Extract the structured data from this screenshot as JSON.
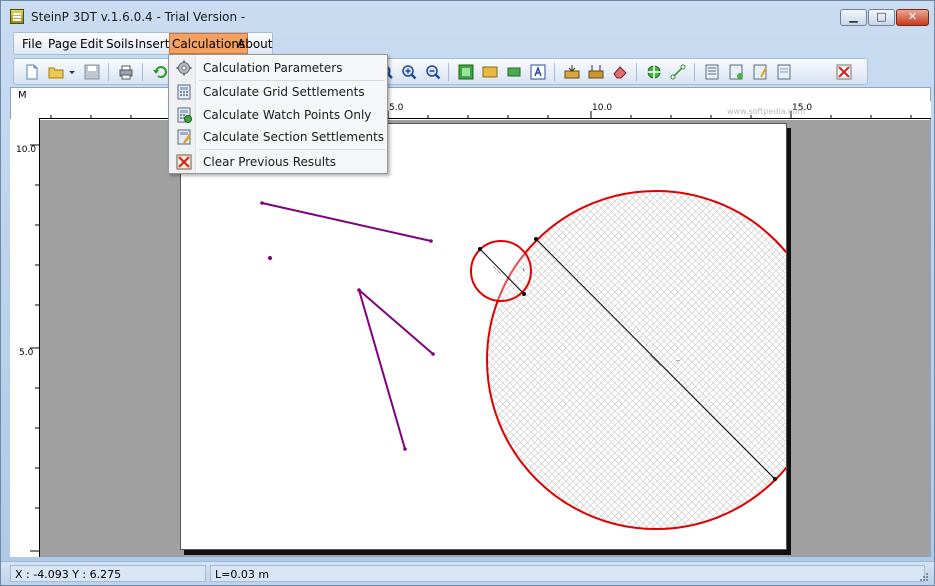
{
  "window": {
    "title": "SteinP 3DT v.1.6.0.4 - Trial Version -",
    "minimize_glyph": "▁",
    "maximize_glyph": "□",
    "close_glyph": "✕"
  },
  "menubar": {
    "items": [
      {
        "label": "File",
        "active": false
      },
      {
        "label": "Page",
        "active": false
      },
      {
        "label": "Edit",
        "active": false
      },
      {
        "label": "Soils",
        "active": false
      },
      {
        "label": "Insert",
        "active": false
      },
      {
        "label": "Calculations",
        "active": true
      },
      {
        "label": "About",
        "active": false
      }
    ]
  },
  "toolbar": {
    "icons": [
      "new-icon",
      "open-icon",
      "open-dropdown-icon",
      "save-icon",
      "print-icon",
      "undo-icon",
      "zoom-window-icon",
      "zoom-in-icon",
      "zoom-out-icon",
      "grid-green-icon",
      "grid-yellow-icon",
      "layer-icon",
      "text-frame-icon",
      "insert-load-icon",
      "insert-load-2-icon",
      "eraser-icon",
      "center-target-icon",
      "measure-icon",
      "calc-params-icon",
      "calc-grid-icon",
      "calc-watch-icon",
      "calc-section-icon",
      "clear-results-icon"
    ]
  },
  "calculations_menu": {
    "items": [
      {
        "label": "Calculation Parameters",
        "icon": "gear-icon"
      },
      {
        "label": "Calculate Grid Settlements",
        "icon": "calculator-icon"
      },
      {
        "label": "Calculate Watch Points Only",
        "icon": "calculator-watch-icon"
      },
      {
        "label": "Calculate Section Settlements",
        "icon": "calculator-pencil-icon"
      },
      {
        "label": "Clear Previous Results",
        "icon": "clear-results-icon"
      }
    ]
  },
  "ruler": {
    "units": "M",
    "h_labels": [
      "5.0",
      "10.0",
      "15.0"
    ],
    "v_labels": [
      "10.0",
      "5.0"
    ]
  },
  "watermark": "www.softpedia.com",
  "statusbar": {
    "coords": "X : -4.093 Y : 6.275",
    "length": "L=0.03 m"
  },
  "colors": {
    "menu_highlight": "#f4a060",
    "line_color": "#800080",
    "circle_color": "#e00000"
  }
}
